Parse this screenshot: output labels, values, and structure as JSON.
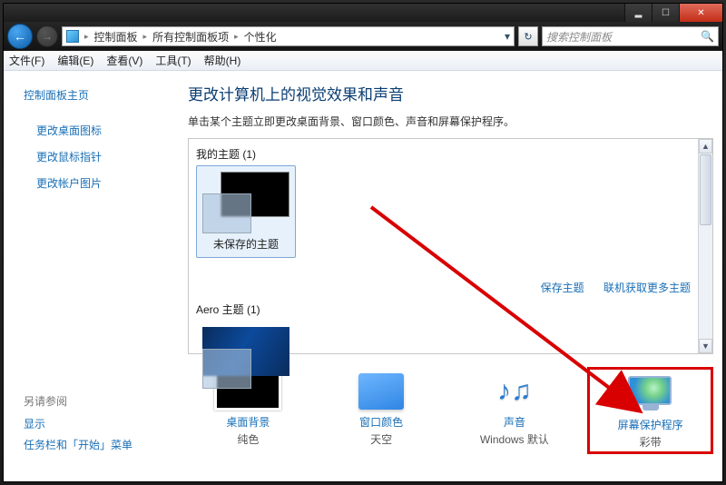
{
  "window_controls": {
    "min": "▂",
    "max": "☐",
    "close": "✕"
  },
  "breadcrumb": {
    "root": "控制面板",
    "items": "所有控制面板项",
    "leaf": "个性化"
  },
  "search": {
    "placeholder": "搜索控制面板"
  },
  "menu": {
    "file": "文件(F)",
    "edit": "编辑(E)",
    "view": "查看(V)",
    "tools": "工具(T)",
    "help": "帮助(H)"
  },
  "sidebar": {
    "home": "控制面板主页",
    "links": {
      "icons": "更改桌面图标",
      "pointers": "更改鼠标指针",
      "account_pic": "更改帐户图片"
    },
    "see_also": "另请参阅",
    "display": "显示",
    "taskbar": "任务栏和「开始」菜单"
  },
  "main": {
    "title": "更改计算机上的视觉效果和声音",
    "desc": "单击某个主题立即更改桌面背景、窗口颜色、声音和屏幕保护程序。",
    "group_my": "我的主题 (1)",
    "unsaved_theme": "未保存的主题",
    "group_aero": "Aero 主题 (1)",
    "save_theme": "保存主题",
    "more_themes": "联机获取更多主题"
  },
  "cards": {
    "bg": {
      "t1": "桌面背景",
      "t2": "纯色"
    },
    "color": {
      "t1": "窗口颜色",
      "t2": "天空"
    },
    "sound": {
      "t1": "声音",
      "t2": "Windows 默认"
    },
    "saver": {
      "t1": "屏幕保护程序",
      "t2": "彩带"
    }
  },
  "help": "?"
}
